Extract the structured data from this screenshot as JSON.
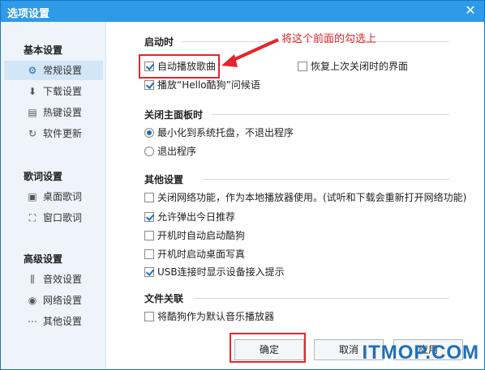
{
  "window": {
    "title": "选项设置",
    "close_glyph": "✕"
  },
  "sidebar": {
    "groups": [
      {
        "title": "基本设置",
        "items": [
          {
            "label": "常规设置",
            "icon": "gear-icon",
            "active": true
          },
          {
            "label": "下载设置",
            "icon": "download-icon"
          },
          {
            "label": "热键设置",
            "icon": "keyboard-icon"
          },
          {
            "label": "软件更新",
            "icon": "update-icon"
          }
        ]
      },
      {
        "title": "歌词设置",
        "items": [
          {
            "label": "桌面歌词",
            "icon": "desktop-lyrics-icon"
          },
          {
            "label": "窗口歌词",
            "icon": "window-lyrics-icon"
          }
        ]
      },
      {
        "title": "高级设置",
        "items": [
          {
            "label": "音效设置",
            "icon": "equalizer-icon"
          },
          {
            "label": "网络设置",
            "icon": "network-icon"
          },
          {
            "label": "其他设置",
            "icon": "more-icon"
          }
        ]
      }
    ]
  },
  "startup": {
    "title": "启动时",
    "auto_play": {
      "label": "自动播放歌曲",
      "checked": true
    },
    "restore": {
      "label": "恢复上次关闭时的界面",
      "checked": false
    },
    "greeting": {
      "label": "播放“Hello酷狗”问候语",
      "checked": true
    }
  },
  "close_panel": {
    "title": "关闭主面板时",
    "minimize": {
      "label": "最小化到系统托盘，不退出程序",
      "checked": true
    },
    "exit": {
      "label": "退出程序",
      "checked": false
    }
  },
  "other": {
    "title": "其他设置",
    "options": [
      {
        "label": "关闭网络功能，作为本地播放器使用。(试听和下载会重新打开网络功能)",
        "checked": false
      },
      {
        "label": "允许弹出今日推荐",
        "checked": true
      },
      {
        "label": "开机时自动启动酷狗",
        "checked": false
      },
      {
        "label": "开机时启动桌面写真",
        "checked": false
      },
      {
        "label": "USB连接时显示设备接入提示",
        "checked": true
      }
    ]
  },
  "file_assoc": {
    "title": "文件关联",
    "default_player": {
      "label": "将酷狗作为默认音乐播放器",
      "checked": false
    }
  },
  "buttons": {
    "ok": "确定",
    "cancel": "取消",
    "apply": "应用"
  },
  "annotation": {
    "text": "将这个前面的勾选上",
    "color": "#e3262b"
  },
  "watermark": "ITMOP.COM"
}
